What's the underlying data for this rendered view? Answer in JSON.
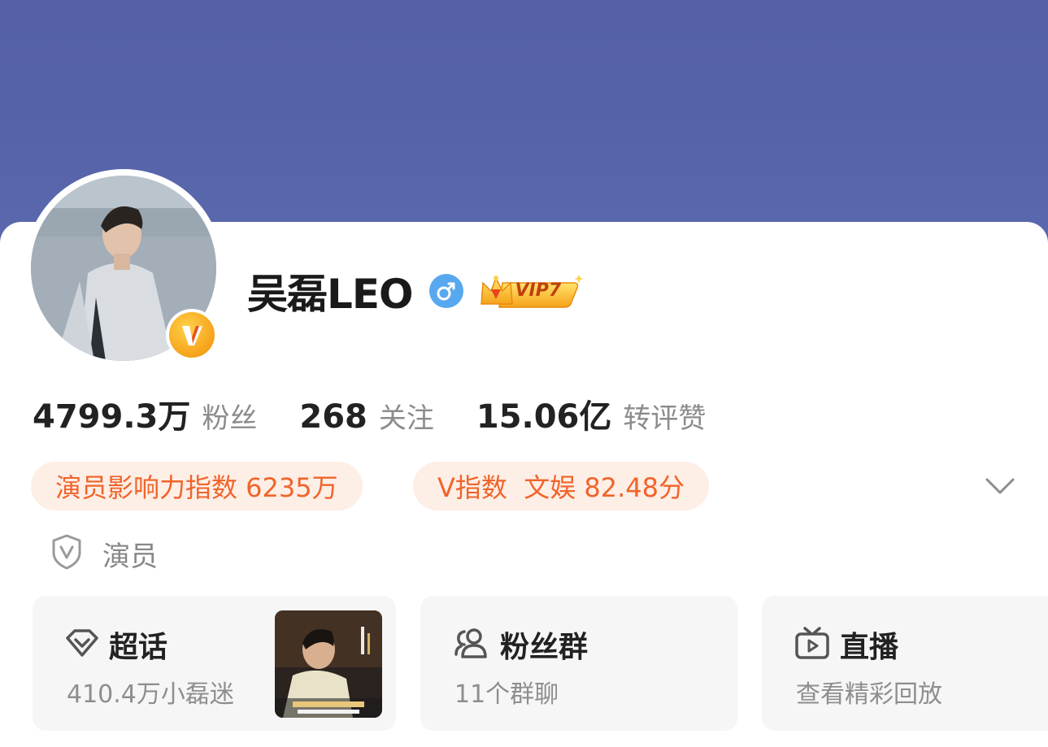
{
  "profile": {
    "name": "吴磊LEO",
    "vip_label": "VIP7"
  },
  "stats": [
    {
      "value": "4799.3万",
      "label": "粉丝"
    },
    {
      "value": "268",
      "label": "关注"
    },
    {
      "value": "15.06亿",
      "label": "转评赞"
    }
  ],
  "chips": {
    "influence": "演员影响力指数 6235万",
    "v_index": "V指数  文娱 82.48分"
  },
  "role": {
    "label": "演员"
  },
  "cards": {
    "supertopic": {
      "title": "超话",
      "sub": "410.4万小磊迷"
    },
    "fangroup": {
      "title": "粉丝群",
      "sub": "11个群聊"
    },
    "live": {
      "title": "直播",
      "sub": "查看精彩回放"
    }
  },
  "colors": {
    "cover": "#5663a9",
    "chip_bg": "#fdeee6",
    "chip_text": "#f0642a",
    "gender_badge": "#58a8f0",
    "vip_gold": "#f6a21a"
  },
  "icons": {
    "verified": "orange-v-icon",
    "gender": "male-icon",
    "vip": "crown-icon",
    "expand": "chevron-down-icon",
    "role": "shield-v-icon",
    "supertopic": "diamond-icon",
    "fangroup": "people-icon",
    "live": "tv-play-icon"
  }
}
